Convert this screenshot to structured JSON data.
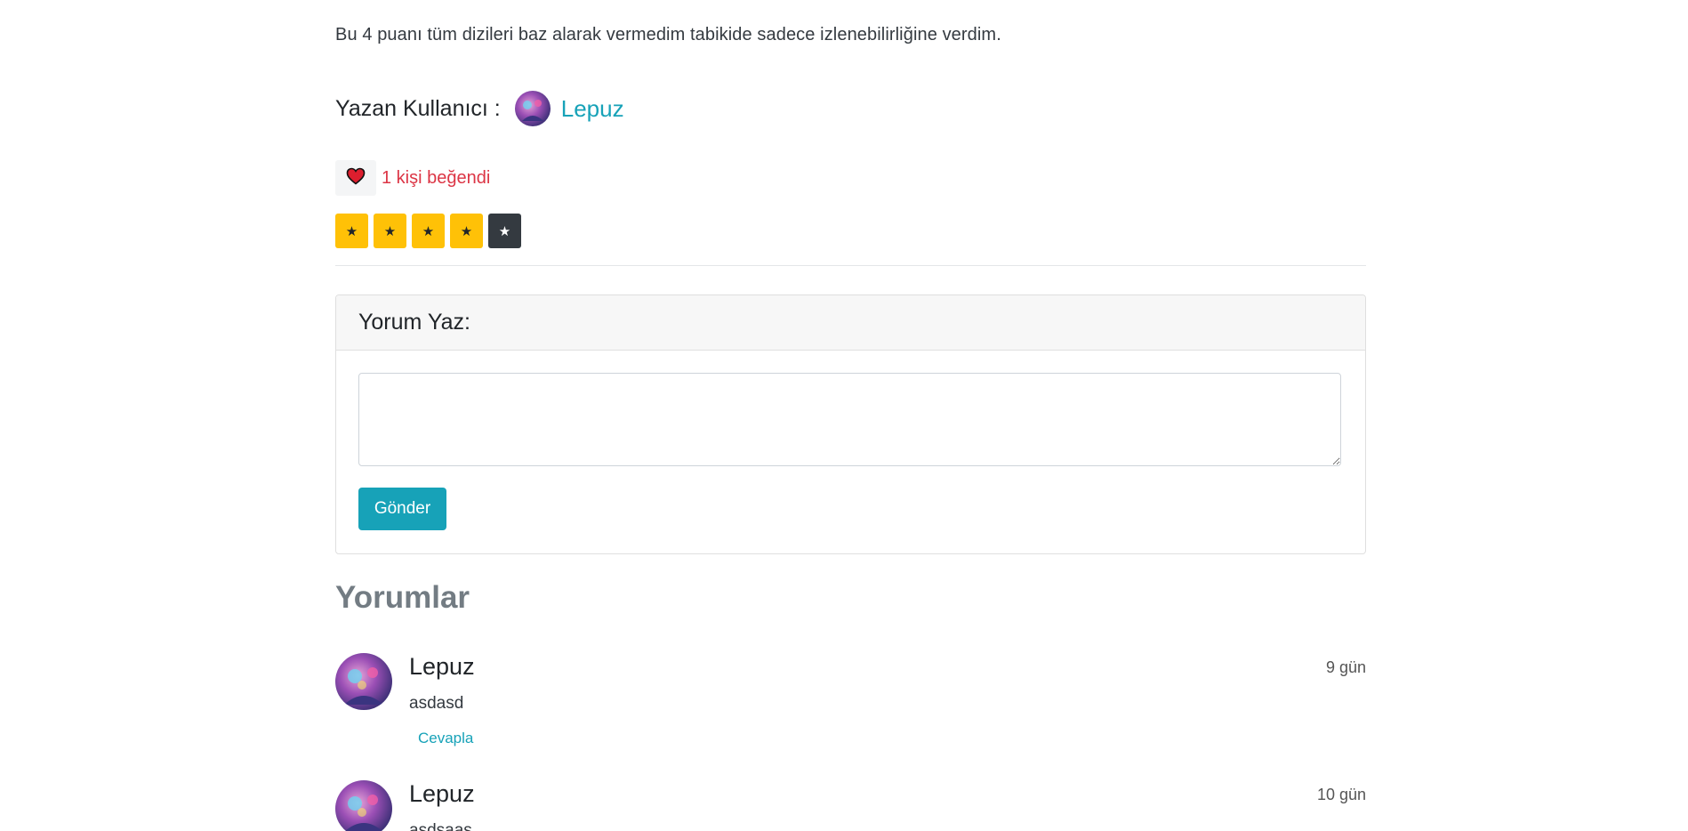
{
  "review": {
    "text": "Bu 4 puanı tüm dizileri baz alarak vermedim tabikide sadece izlenebilirliğine verdim.",
    "author_label": "Yazan Kullanıcı :",
    "author_name": "Lepuz"
  },
  "likes": {
    "text": "1 kişi beğendi",
    "icon": "heart-icon",
    "color": "#dc3545"
  },
  "rating": {
    "value": 4,
    "max": 5,
    "glyph": "★",
    "filled_color": "#ffc107",
    "empty_color": "#343a40"
  },
  "comment_form": {
    "title": "Yorum Yaz:",
    "textarea_value": "",
    "submit_label": "Gönder"
  },
  "comments_section": {
    "title": "Yorumlar",
    "items": [
      {
        "author": "Lepuz",
        "time": "9 gün",
        "body": "asdasd",
        "reply_label": "Cevapla"
      },
      {
        "author": "Lepuz",
        "time": "10 gün",
        "body": "asdsaas"
      }
    ]
  },
  "colors": {
    "accent": "#17a2b8",
    "danger": "#dc3545"
  }
}
